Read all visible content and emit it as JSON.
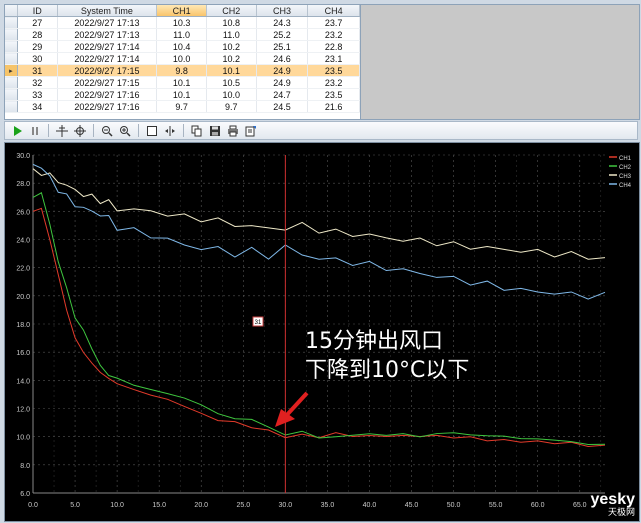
{
  "table": {
    "columns": [
      "ID",
      "System Time",
      "CH1",
      "CH2",
      "CH3",
      "CH4"
    ],
    "rows": [
      {
        "id": "27",
        "time": "2022/9/27 17:13",
        "ch1": "10.3",
        "ch2": "10.8",
        "ch3": "24.3",
        "ch4": "23.7"
      },
      {
        "id": "28",
        "time": "2022/9/27 17:13",
        "ch1": "11.0",
        "ch2": "11.0",
        "ch3": "25.2",
        "ch4": "23.2"
      },
      {
        "id": "29",
        "time": "2022/9/27 17:14",
        "ch1": "10.4",
        "ch2": "10.2",
        "ch3": "25.1",
        "ch4": "22.8"
      },
      {
        "id": "30",
        "time": "2022/9/27 17:14",
        "ch1": "10.0",
        "ch2": "10.2",
        "ch3": "24.6",
        "ch4": "23.1"
      },
      {
        "id": "31",
        "time": "2022/9/27 17:15",
        "ch1": "9.8",
        "ch2": "10.1",
        "ch3": "24.9",
        "ch4": "23.5",
        "selected": true
      },
      {
        "id": "32",
        "time": "2022/9/27 17:15",
        "ch1": "10.1",
        "ch2": "10.5",
        "ch3": "24.9",
        "ch4": "23.2"
      },
      {
        "id": "33",
        "time": "2022/9/27 17:16",
        "ch1": "10.1",
        "ch2": "10.0",
        "ch3": "24.7",
        "ch4": "23.5"
      },
      {
        "id": "34",
        "time": "2022/9/27 17:16",
        "ch1": "9.7",
        "ch2": "9.7",
        "ch3": "24.5",
        "ch4": "21.6"
      }
    ]
  },
  "toolbar": {
    "icons": [
      "play-icon",
      "pause-icon",
      "crosshair-icon",
      "target-icon",
      "zoom-out-icon",
      "zoom-in-icon",
      "select-box-icon",
      "fit-icon",
      "copy-icon",
      "save-icon",
      "print-icon",
      "export-icon"
    ]
  },
  "chart_data": {
    "type": "line",
    "ylim": [
      6.0,
      30.0
    ],
    "xlim": [
      0.0,
      68.0
    ],
    "y_ticks": [
      "6.0",
      "8.0",
      "10.0",
      "12.0",
      "14.0",
      "16.0",
      "18.0",
      "20.0",
      "22.0",
      "24.0",
      "26.0",
      "28.0",
      "30.0"
    ],
    "x_ticks": [
      "0.0",
      "5.0",
      "10.0",
      "15.0",
      "20.0",
      "25.0",
      "30.0",
      "35.0",
      "40.0",
      "45.0",
      "50.0",
      "55.0",
      "60.0",
      "65.0"
    ],
    "grid": true,
    "legend_position": "top-right",
    "cursor_x": 30.0,
    "cursor_label": "31",
    "x": [
      0,
      1,
      2,
      3,
      4,
      5,
      6,
      7,
      8,
      9,
      10,
      12,
      14,
      16,
      18,
      20,
      22,
      24,
      26,
      28,
      30,
      32,
      34,
      36,
      38,
      40,
      42,
      44,
      46,
      48,
      50,
      52,
      54,
      56,
      58,
      60,
      62,
      64,
      66,
      68
    ],
    "series": [
      {
        "name": "CH1",
        "color": "#e23a2a",
        "values": [
          26.0,
          26.2,
          24.0,
          21.5,
          19.0,
          17.0,
          16.0,
          15.2,
          14.6,
          14.1,
          13.8,
          13.3,
          13.0,
          12.6,
          12.2,
          11.6,
          11.2,
          11.0,
          10.7,
          10.4,
          10.0,
          10.1,
          10.0,
          10.2,
          10.1,
          10.0,
          10.1,
          10.0,
          10.1,
          10.0,
          10.0,
          9.9,
          9.8,
          9.7,
          9.7,
          9.6,
          9.6,
          9.5,
          9.4,
          9.3
        ]
      },
      {
        "name": "CH2",
        "color": "#3fc63f",
        "values": [
          26.9,
          27.4,
          25.0,
          22.5,
          20.5,
          18.5,
          17.5,
          16.3,
          15.0,
          14.4,
          14.1,
          13.7,
          13.3,
          13.1,
          12.7,
          12.3,
          11.6,
          11.3,
          11.2,
          10.7,
          10.1,
          10.4,
          9.9,
          10.0,
          10.1,
          10.2,
          10.1,
          10.2,
          10.0,
          10.2,
          10.3,
          10.1,
          10.1,
          10.0,
          9.9,
          9.8,
          9.8,
          9.6,
          9.5,
          9.4
        ]
      },
      {
        "name": "CH3",
        "color": "#efe9c8",
        "values": [
          28.8,
          28.8,
          28.5,
          28.2,
          27.8,
          27.5,
          27.2,
          27.0,
          26.8,
          26.6,
          26.2,
          26.1,
          26.0,
          25.8,
          25.6,
          25.5,
          25.3,
          25.1,
          24.9,
          24.8,
          24.8,
          25.0,
          24.7,
          24.5,
          24.4,
          24.3,
          24.1,
          24.0,
          23.9,
          23.8,
          23.6,
          23.5,
          23.4,
          23.3,
          23.2,
          23.1,
          23.0,
          22.9,
          22.8,
          22.6
        ]
      },
      {
        "name": "CH4",
        "color": "#7fb8e8",
        "values": [
          29.3,
          29.2,
          28.3,
          27.6,
          27.0,
          26.5,
          26.2,
          26.0,
          25.8,
          25.5,
          24.9,
          24.6,
          24.3,
          24.0,
          23.6,
          23.4,
          23.3,
          23.0,
          23.2,
          22.8,
          23.5,
          22.9,
          22.7,
          22.5,
          22.4,
          22.2,
          22.0,
          21.8,
          21.6,
          21.4,
          21.2,
          21.0,
          20.8,
          20.6,
          20.4,
          20.3,
          20.2,
          20.1,
          20.0,
          20.0
        ]
      }
    ],
    "annotation": {
      "line1": "15分钟出风口",
      "line2": "下降到10°C以下",
      "color": "#ffffff",
      "arrow_color": "#e02020"
    }
  },
  "watermark": {
    "brand": "yesky",
    "sub": "天极网"
  }
}
